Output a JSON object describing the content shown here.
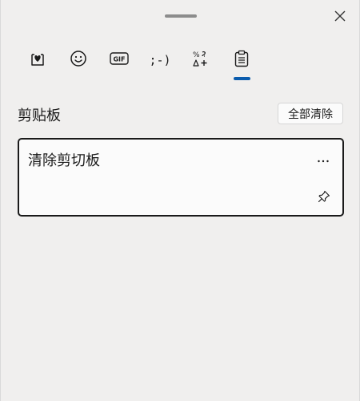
{
  "header": {
    "drag_handle": "drag-handle",
    "close_icon": "close-icon"
  },
  "tabs": [
    {
      "name": "favorites",
      "icon": "heart-board-icon"
    },
    {
      "name": "emoji",
      "icon": "smiley-icon"
    },
    {
      "name": "gif",
      "icon": "gif-icon",
      "label": "GIF"
    },
    {
      "name": "kaomoji",
      "icon": "kaomoji-icon",
      "label": ";-)"
    },
    {
      "name": "symbols",
      "icon": "symbols-icon"
    },
    {
      "name": "clipboard",
      "icon": "clipboard-icon",
      "selected": true
    }
  ],
  "clipboard": {
    "title": "剪贴板",
    "clear_all_label": "全部清除",
    "items": [
      {
        "text": "清除剪切板"
      }
    ]
  },
  "colors": {
    "accent": "#0b5cad",
    "background": "#f0efee",
    "card": "#fbfbfb",
    "text": "#1a1a1a"
  }
}
